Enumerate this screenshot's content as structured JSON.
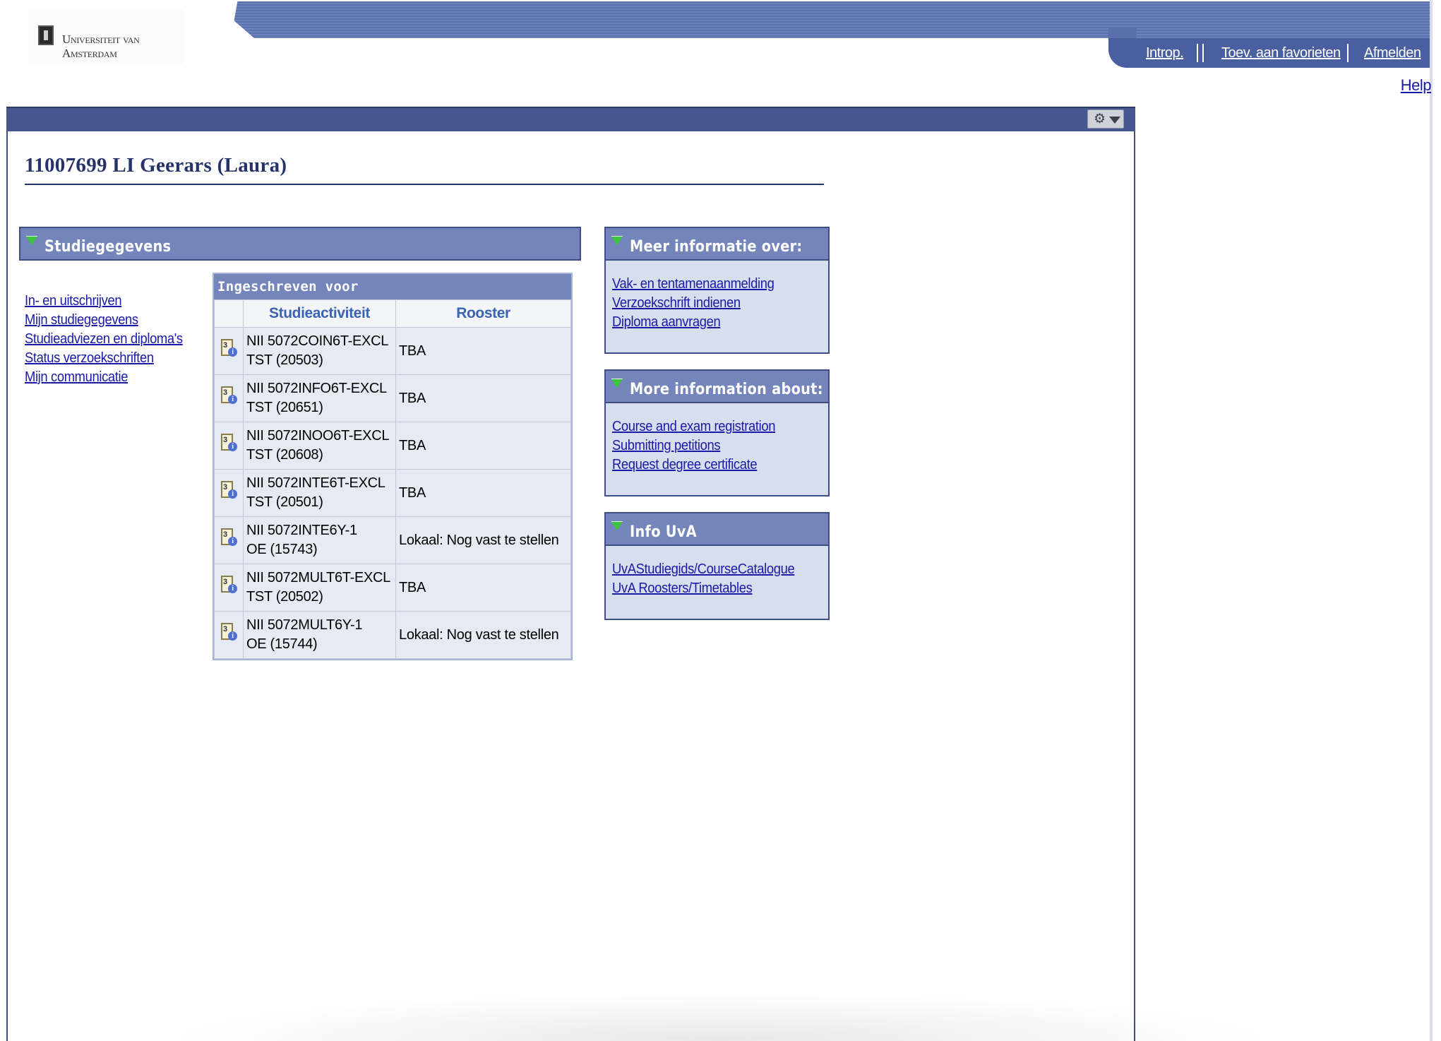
{
  "header": {
    "logo_text": "Universiteit van Amsterdam",
    "nav": [
      "Introp.",
      "Toev. aan favorieten",
      "Afmelden"
    ],
    "help": "Help"
  },
  "page": {
    "title": "11007699 LI Geerars (Laura)"
  },
  "studiegegevens": {
    "heading": "Studiegegevens",
    "links": [
      "In- en uitschrijven",
      "Mijn studiegegevens",
      "Studieadviezen en diploma's",
      "Status verzoekschriften",
      "Mijn communicatie"
    ],
    "table": {
      "caption": "Ingeschreven voor",
      "columns": [
        "Studieactiviteit",
        "Rooster"
      ],
      "rows": [
        {
          "activity_line1": "NII 5072COIN6T-EXCL",
          "activity_line2": "TST (20503)",
          "rooster": "TBA"
        },
        {
          "activity_line1": "NII 5072INFO6T-EXCL",
          "activity_line2": "TST (20651)",
          "rooster": "TBA"
        },
        {
          "activity_line1": "NII 5072INOO6T-EXCL",
          "activity_line2": "TST (20608)",
          "rooster": "TBA"
        },
        {
          "activity_line1": "NII 5072INTE6T-EXCL",
          "activity_line2": "TST (20501)",
          "rooster": "TBA"
        },
        {
          "activity_line1": "NII 5072INTE6Y-1",
          "activity_line2": "OE (15743)",
          "rooster": "Lokaal: Nog vast te stellen"
        },
        {
          "activity_line1": "NII 5072MULT6T-EXCL",
          "activity_line2": "TST (20502)",
          "rooster": "TBA"
        },
        {
          "activity_line1": "NII 5072MULT6Y-1",
          "activity_line2": "OE (15744)",
          "rooster": "Lokaal: Nog vast te stellen"
        }
      ]
    }
  },
  "meer_info": {
    "heading": "Meer informatie over:",
    "links": [
      "Vak- en tentamenaanmelding",
      "Verzoekschrift indienen",
      "Diploma aanvragen"
    ]
  },
  "more_info": {
    "heading": "More information about:",
    "links": [
      "Course and exam registration",
      "Submitting petitions",
      "Request degree certificate"
    ]
  },
  "info_uva": {
    "heading": "Info UvA",
    "links": [
      "UvAStudiegids/CourseCatalogue",
      "UvA Roosters/Timetables"
    ]
  },
  "icons": {
    "gear": "gear-icon",
    "collapse": "triangle-down-icon",
    "row_icon": "calendar-info-icon"
  },
  "colors": {
    "header_bar": "#46578f",
    "section_head": "#7485bb",
    "title": "#26336b",
    "link": "#1a1aa6",
    "collapse_triangle": "#3cc43c"
  }
}
